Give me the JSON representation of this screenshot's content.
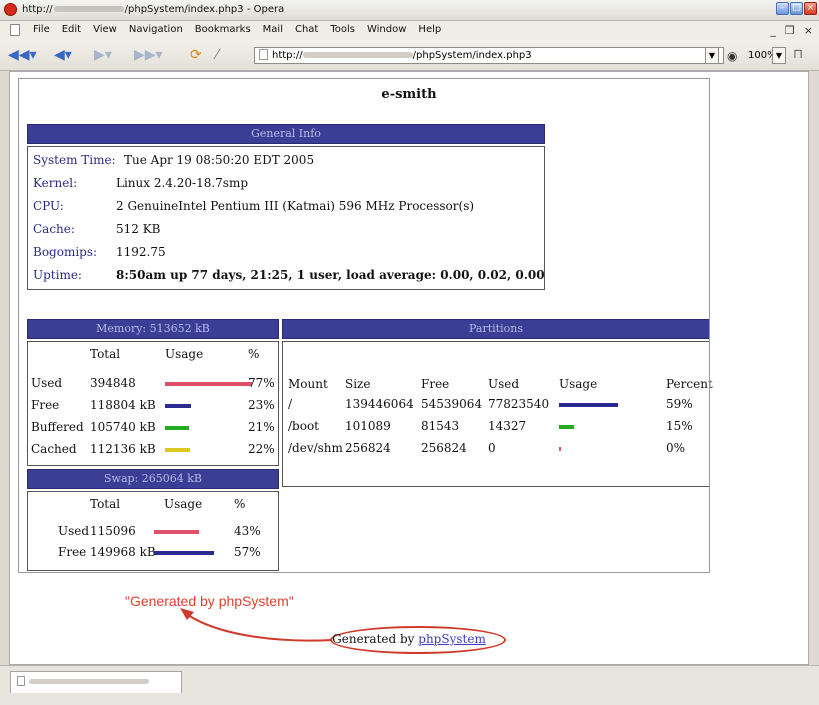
{
  "window": {
    "title_prefix": "http://",
    "title_suffix": "/phpSystem/index.php3 - Opera"
  },
  "menu": {
    "items": [
      "File",
      "Edit",
      "View",
      "Navigation",
      "Bookmarks",
      "Mail",
      "Chat",
      "Tools",
      "Window",
      "Help"
    ]
  },
  "toolbar": {
    "address_prefix": "http://",
    "address_suffix": "/phpSystem/index.php3",
    "zoom": "100%"
  },
  "page": {
    "hostname": "e-smith",
    "general_info": {
      "header": "General Info",
      "rows": [
        {
          "label": "System Time:",
          "value": "Tue Apr 19 08:50:20 EDT 2005"
        },
        {
          "label": "Kernel:",
          "value": "Linux 2.4.20-18.7smp"
        },
        {
          "label": "CPU:",
          "value": "2 GenuineIntel Pentium III (Katmai) 596 MHz Processor(s)"
        },
        {
          "label": "Cache:",
          "value": "512 KB"
        },
        {
          "label": "Bogomips:",
          "value": "1192.75"
        },
        {
          "label": "Uptime:",
          "value": "8:50am up 77 days, 21:25, 1 user, load average: 0.00, 0.02, 0.00"
        }
      ]
    },
    "memory": {
      "header": "Memory: 513652 kB",
      "columns": [
        "Total",
        "Usage",
        "%"
      ],
      "rows": [
        {
          "label": "Used",
          "total": "394848",
          "percent": "77%",
          "fraction": 0.77,
          "color": "#e05068"
        },
        {
          "label": "Free",
          "total": "118804 kB",
          "percent": "23%",
          "fraction": 0.23,
          "color": "#2a2a90"
        },
        {
          "label": "Buffered",
          "total": "105740 kB",
          "percent": "21%",
          "fraction": 0.21,
          "color": "#22aa22"
        },
        {
          "label": "Cached",
          "total": "112136 kB",
          "percent": "22%",
          "fraction": 0.22,
          "color": "#dcc81e"
        }
      ]
    },
    "swap": {
      "header": "Swap: 265064 kB",
      "columns": [
        "Total",
        "Usage",
        "%"
      ],
      "rows": [
        {
          "label": "Used",
          "total": "115096",
          "percent": "43%",
          "fraction": 0.43,
          "color": "#e05068"
        },
        {
          "label": "Free",
          "total": "149968 kB",
          "percent": "57%",
          "fraction": 0.57,
          "color": "#2a2a90"
        }
      ]
    },
    "partitions": {
      "header": "Partitions",
      "columns": [
        "Mount",
        "Size",
        "Free",
        "Used",
        "Usage",
        "Percent"
      ],
      "rows": [
        {
          "mount": "/",
          "size": "139446064",
          "free": "54539064",
          "used": "77823540",
          "percent": "59%",
          "fraction": 0.59,
          "color": "#2a2a90"
        },
        {
          "mount": "/boot",
          "size": "101089",
          "free": "81543",
          "used": "14327",
          "percent": "15%",
          "fraction": 0.15,
          "color": "#22aa22"
        },
        {
          "mount": "/dev/shm",
          "size": "256824",
          "free": "256824",
          "used": "0",
          "percent": "0%",
          "fraction": 0.0,
          "color": "#e05068"
        }
      ]
    },
    "footer": {
      "text": "Generated by ",
      "link": "phpSystem"
    },
    "annotation": "\"Generated by phpSystem\""
  },
  "colors": {
    "header_bg": "#3c3e96",
    "header_text": "#b8bae8",
    "label_text": "#2b2b86",
    "annotation": "#e04030"
  }
}
